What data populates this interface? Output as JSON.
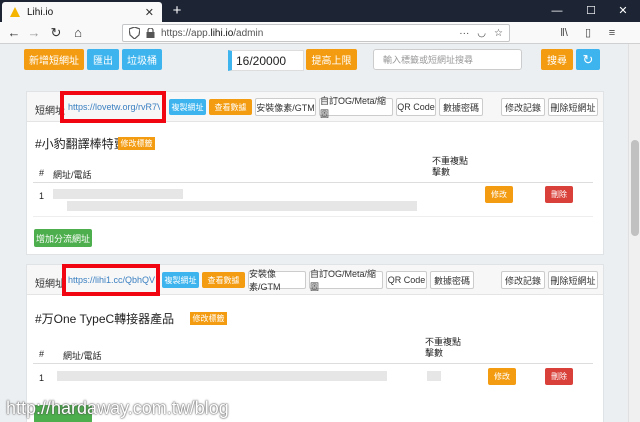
{
  "browser": {
    "tab_title": "Lihi.io",
    "url_prefix": "https://app.",
    "url_domain": "lihi.io",
    "url_path": "/admin"
  },
  "toolbar": {
    "new_short_url": "新增短網址",
    "export": "匯出",
    "trash": "垃圾桶",
    "counter": "16/20000",
    "raise_limit": "提高上限",
    "search_placeholder": "輸入標籤或短網址搜尋",
    "search_button": "搜尋"
  },
  "panels": [
    {
      "short_label": "短網址",
      "short_url": "https://lovetw.org/rvR7V",
      "actions": {
        "copy": "複製網址",
        "view_data": "查看數據",
        "install_pixel": "安裝像素/GTM",
        "custom_og": "自訂OG/Meta/縮圖",
        "qr": "QR Code",
        "data_password": "數據密碼",
        "history": "修改記錄",
        "delete_url": "刪除短網址"
      },
      "title": "#小豹翻譯棒特賣",
      "edit_title": "修改標籤",
      "table": {
        "col_num": "#",
        "col_url": "網址/電話",
        "col_unique": "不重複點擊數",
        "rows": [
          {
            "num": "1",
            "edit": "修改",
            "delete": "刪除"
          }
        ]
      },
      "add_split": "增加分流網址"
    },
    {
      "short_label": "短網址",
      "short_url": "https://lihi1.cc/QbhQV",
      "actions": {
        "copy": "複製網址",
        "view_data": "查看數據",
        "install_pixel": "安裝像素/GTM",
        "custom_og": "自訂OG/Meta/縮圖",
        "qr": "QR Code",
        "data_password": "數據密碼",
        "history": "修改記錄",
        "delete_url": "刪除短網址"
      },
      "title": "#万One TypeC轉接器產品",
      "edit_title": "修改標籤",
      "table": {
        "col_num": "#",
        "col_url": "網址/電話",
        "col_unique": "不重複點擊數",
        "rows": [
          {
            "num": "1",
            "edit": "修改",
            "delete": "刪除"
          }
        ]
      }
    }
  ],
  "watermark": "http://hardaway.com.tw/blog",
  "colors": {
    "orange": "#f39c12",
    "blue": "#3db4ee",
    "red": "#d9403a",
    "green": "#4cae4c",
    "highlight": "#f00511"
  }
}
